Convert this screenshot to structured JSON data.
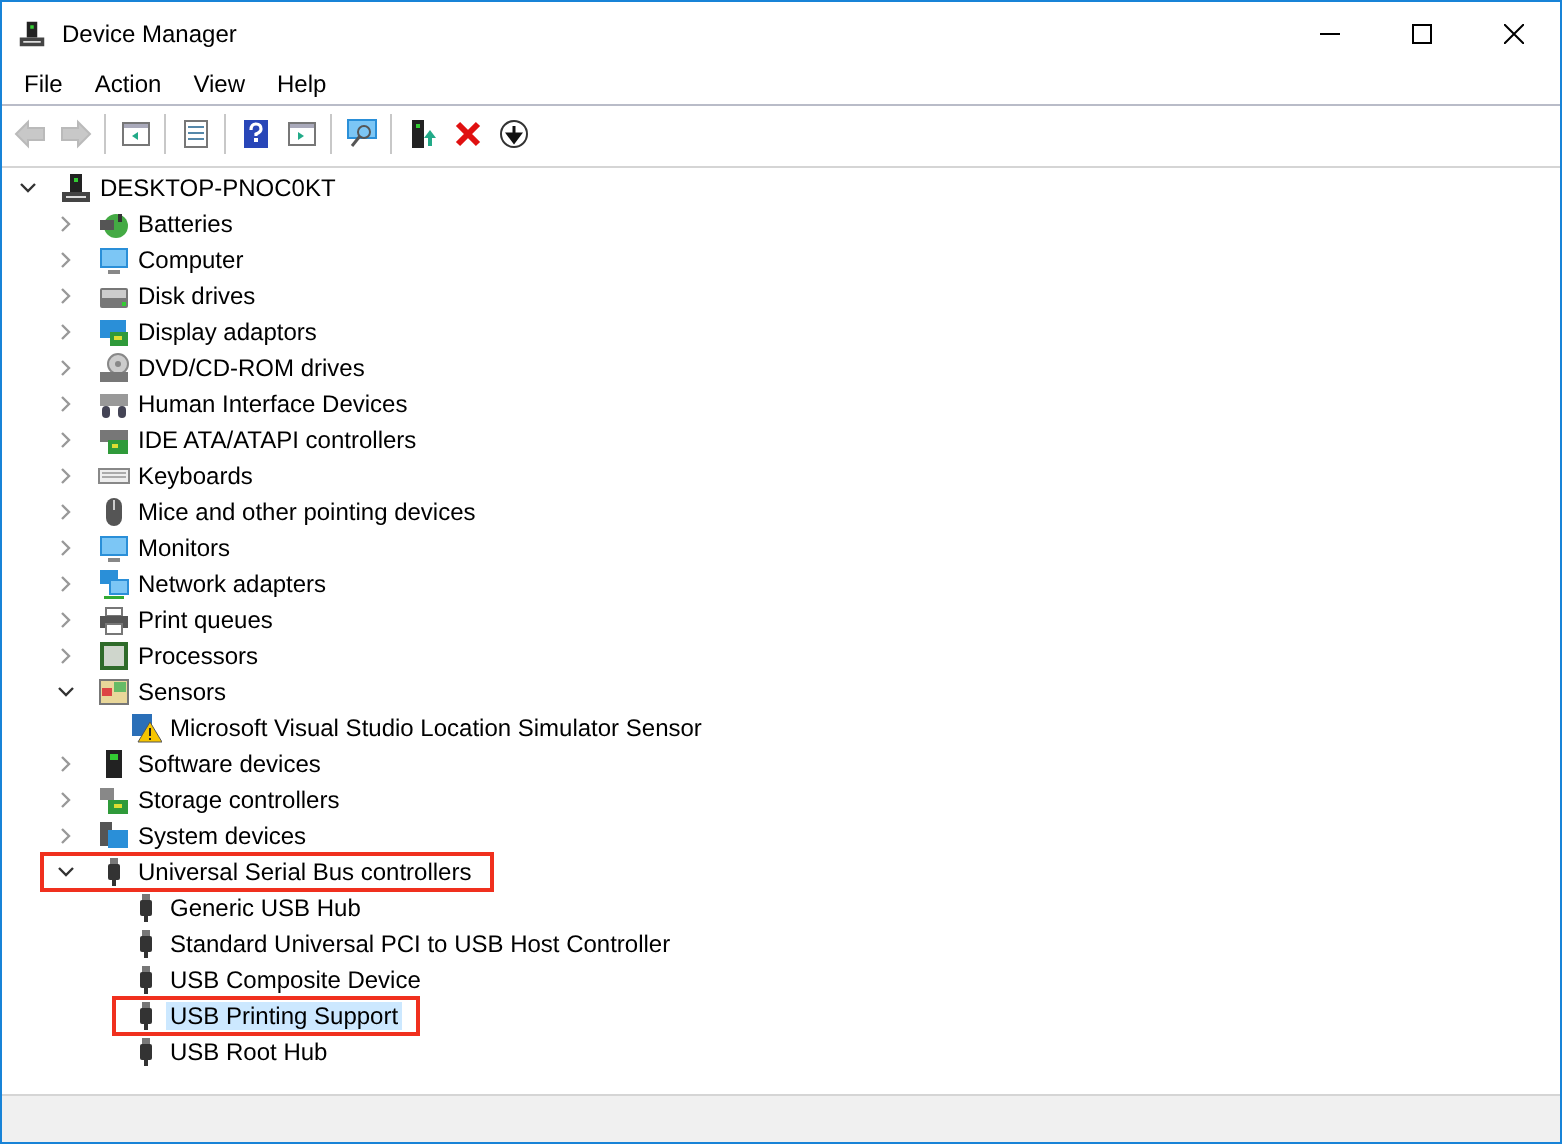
{
  "window": {
    "title": "Device Manager"
  },
  "menu": [
    "File",
    "Action",
    "View",
    "Help"
  ],
  "toolbar": [
    {
      "kind": "back",
      "disabled": true
    },
    {
      "kind": "forward",
      "disabled": true
    },
    {
      "kind": "separator"
    },
    {
      "kind": "console-tree",
      "disabled": false
    },
    {
      "kind": "separator"
    },
    {
      "kind": "properties",
      "disabled": false
    },
    {
      "kind": "separator"
    },
    {
      "kind": "help",
      "disabled": false
    },
    {
      "kind": "action-pane",
      "disabled": false
    },
    {
      "kind": "separator"
    },
    {
      "kind": "scan",
      "disabled": false
    },
    {
      "kind": "separator"
    },
    {
      "kind": "update",
      "disabled": false
    },
    {
      "kind": "uninstall",
      "disabled": false
    },
    {
      "kind": "disable",
      "disabled": false
    }
  ],
  "tree": {
    "label": "DESKTOP-PNOC0KT",
    "kind": "computer",
    "expanded": true,
    "selected": false,
    "highlighted": false,
    "children": [
      {
        "label": "Batteries",
        "kind": "battery",
        "expanded": false,
        "selected": false,
        "highlighted": false
      },
      {
        "label": "Computer",
        "kind": "monitor",
        "expanded": false,
        "selected": false,
        "highlighted": false
      },
      {
        "label": "Disk drives",
        "kind": "disk",
        "expanded": false,
        "selected": false,
        "highlighted": false
      },
      {
        "label": "Display adaptors",
        "kind": "display",
        "expanded": false,
        "selected": false,
        "highlighted": false
      },
      {
        "label": "DVD/CD-ROM drives",
        "kind": "dvd",
        "expanded": false,
        "selected": false,
        "highlighted": false
      },
      {
        "label": "Human Interface Devices",
        "kind": "hid",
        "expanded": false,
        "selected": false,
        "highlighted": false
      },
      {
        "label": "IDE ATA/ATAPI controllers",
        "kind": "ide",
        "expanded": false,
        "selected": false,
        "highlighted": false
      },
      {
        "label": "Keyboards",
        "kind": "keyboard",
        "expanded": false,
        "selected": false,
        "highlighted": false
      },
      {
        "label": "Mice and other pointing devices",
        "kind": "mouse",
        "expanded": false,
        "selected": false,
        "highlighted": false
      },
      {
        "label": "Monitors",
        "kind": "monitor",
        "expanded": false,
        "selected": false,
        "highlighted": false
      },
      {
        "label": "Network adapters",
        "kind": "network",
        "expanded": false,
        "selected": false,
        "highlighted": false
      },
      {
        "label": "Print queues",
        "kind": "printer",
        "expanded": false,
        "selected": false,
        "highlighted": false
      },
      {
        "label": "Processors",
        "kind": "processor",
        "expanded": false,
        "selected": false,
        "highlighted": false
      },
      {
        "label": "Sensors",
        "kind": "sensor",
        "expanded": true,
        "selected": false,
        "highlighted": false,
        "children": [
          {
            "label": "Microsoft Visual Studio Location Simulator Sensor",
            "kind": "warning",
            "selected": false,
            "highlighted": false
          }
        ]
      },
      {
        "label": "Software devices",
        "kind": "software",
        "expanded": false,
        "selected": false,
        "highlighted": false
      },
      {
        "label": "Storage controllers",
        "kind": "storage",
        "expanded": false,
        "selected": false,
        "highlighted": false
      },
      {
        "label": "System devices",
        "kind": "system",
        "expanded": false,
        "selected": false,
        "highlighted": false
      },
      {
        "label": "Universal Serial Bus controllers",
        "kind": "usb",
        "expanded": true,
        "selected": false,
        "highlighted": true,
        "children": [
          {
            "label": "Generic USB Hub",
            "kind": "usb",
            "selected": false,
            "highlighted": false
          },
          {
            "label": "Standard Universal PCI to USB Host Controller",
            "kind": "usb",
            "selected": false,
            "highlighted": false
          },
          {
            "label": "USB Composite Device",
            "kind": "usb",
            "selected": false,
            "highlighted": false
          },
          {
            "label": "USB Printing Support",
            "kind": "usb",
            "selected": true,
            "highlighted": true
          },
          {
            "label": "USB Root Hub",
            "kind": "usb",
            "selected": false,
            "highlighted": false
          }
        ]
      }
    ]
  }
}
